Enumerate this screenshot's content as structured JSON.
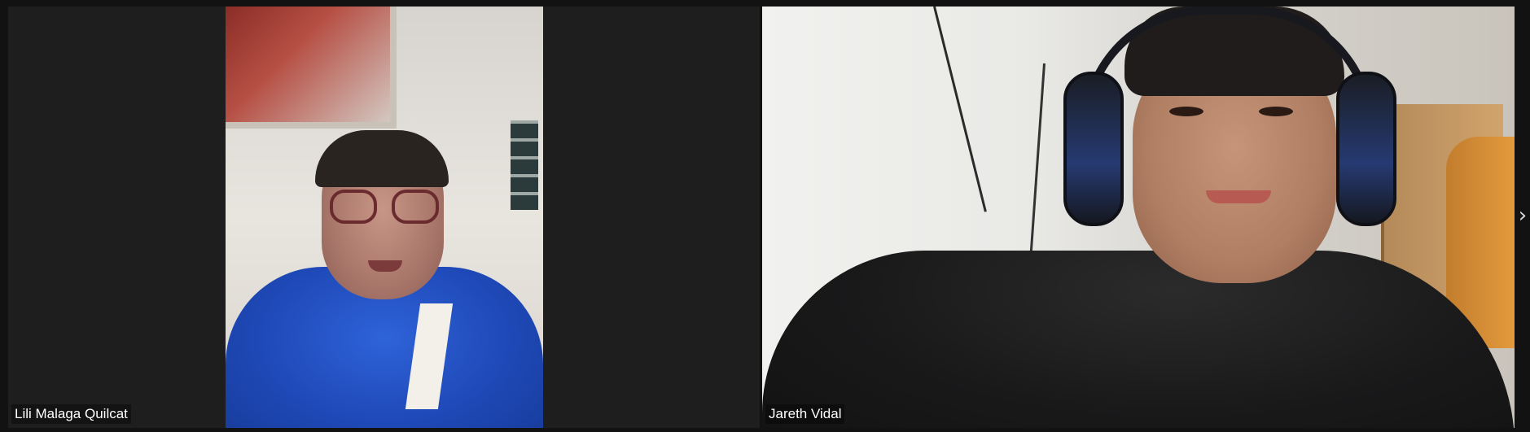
{
  "meeting": {
    "participants": [
      {
        "name": "Lili Malaga Quilcat"
      },
      {
        "name": "Jareth Vidal"
      }
    ],
    "next_page_icon": "chevron-right-icon",
    "next_page_glyph": "›"
  },
  "colors": {
    "background": "#121212",
    "tile_background": "#1e1e1e",
    "name_text": "#ffffff"
  }
}
